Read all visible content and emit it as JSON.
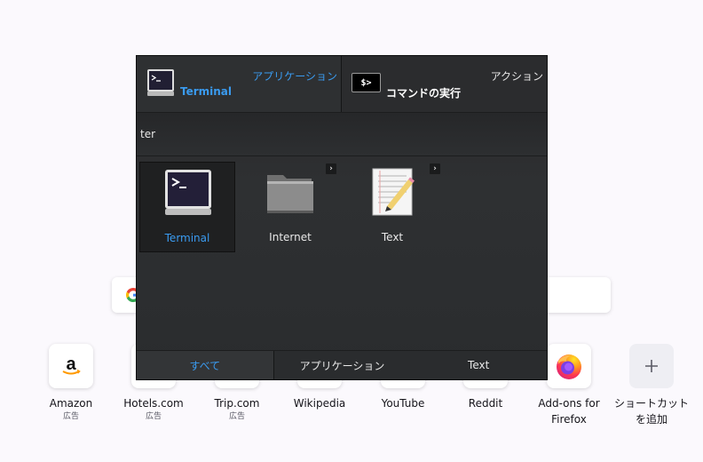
{
  "launcher": {
    "primary": {
      "category": "アプリケーション",
      "name": "Terminal",
      "icon": "terminal-icon"
    },
    "secondary": {
      "category": "アクション",
      "name": "コマンドの実行",
      "icon": "run-command-icon",
      "glyph": "$>"
    },
    "query": "ter",
    "results": [
      {
        "label": "Terminal",
        "icon": "terminal-icon",
        "selected": true
      },
      {
        "label": "Internet",
        "icon": "folder-icon",
        "selected": false
      },
      {
        "label": "Text",
        "icon": "text-editor-icon",
        "selected": false
      }
    ],
    "tabs": [
      {
        "label": "すべて",
        "active": true
      },
      {
        "label": "アプリケーション",
        "active": false
      },
      {
        "label": "Text",
        "active": false
      }
    ],
    "colors": {
      "accent": "#3a9bf0",
      "panel": "#2b2c2e"
    }
  },
  "shortcuts": [
    {
      "label": "Amazon",
      "sub": "広告",
      "icon": "amazon-icon"
    },
    {
      "label": "Hotels.com",
      "sub": "広告",
      "icon": "hotels-icon"
    },
    {
      "label": "Trip.com",
      "sub": "広告",
      "icon": "trip-icon"
    },
    {
      "label": "Wikipedia",
      "sub": "",
      "icon": "wikipedia-icon"
    },
    {
      "label": "YouTube",
      "sub": "",
      "icon": "youtube-icon"
    },
    {
      "label": "Reddit",
      "sub": "",
      "icon": "reddit-icon"
    },
    {
      "label": "Add-ons for\nFirefox",
      "sub": "",
      "icon": "firefox-icon"
    },
    {
      "label": "ショートカット\nを追加",
      "sub": "",
      "icon": "plus-icon"
    }
  ],
  "search": {
    "icon": "google-icon"
  }
}
